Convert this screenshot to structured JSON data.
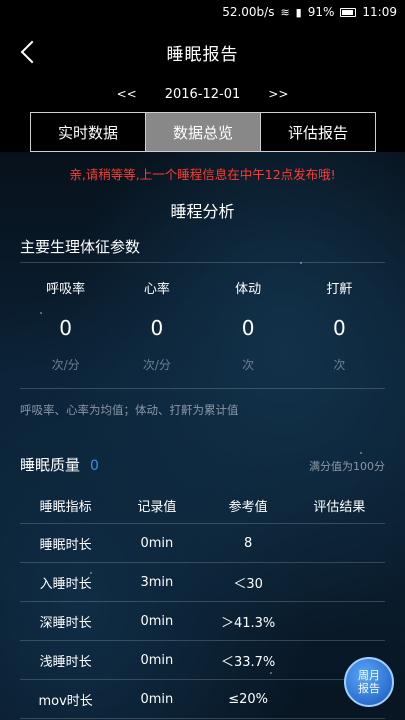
{
  "statusbar": {
    "network_speed": "52.00b/s",
    "battery_percent": "91%",
    "time": "11:09"
  },
  "appbar": {
    "title": "睡眠报告"
  },
  "datebar": {
    "prev": "<<",
    "date": "2016-12-01",
    "next": ">>"
  },
  "tabs": [
    {
      "label": "实时数据",
      "active": false
    },
    {
      "label": "数据总览",
      "active": true
    },
    {
      "label": "评估报告",
      "active": false
    }
  ],
  "notice": "亲,请稍等等,上一个睡程信息在中午12点发布哦!",
  "section_title": "睡程分析",
  "vitals": {
    "title": "主要生理体征参数",
    "metrics": [
      {
        "label": "呼吸率",
        "value": "0",
        "unit": "次/分"
      },
      {
        "label": "心率",
        "value": "0",
        "unit": "次/分"
      },
      {
        "label": "体动",
        "value": "0",
        "unit": "次"
      },
      {
        "label": "打鼾",
        "value": "0",
        "unit": "次"
      }
    ],
    "note": "呼吸率、心率为均值；体动、打鼾为累计值"
  },
  "quality": {
    "title": "睡眠质量",
    "score": "0",
    "full_score_note": "满分值为100分",
    "headers": [
      "睡眠指标",
      "记录值",
      "参考值",
      "评估结果"
    ],
    "rows": [
      {
        "name": "睡眠时长",
        "record": "0min",
        "reference": "8",
        "result": ""
      },
      {
        "name": "入睡时长",
        "record": "3min",
        "reference": "＜30",
        "result": ""
      },
      {
        "name": "深睡时长",
        "record": "0min",
        "reference": "＞41.3%",
        "result": ""
      },
      {
        "name": "浅睡时长",
        "record": "0min",
        "reference": "＜33.7%",
        "result": ""
      },
      {
        "name": "mov时长",
        "record": "0min",
        "reference": "≤20%",
        "result": ""
      }
    ]
  },
  "fab": {
    "line1": "周月",
    "line2": "报告"
  }
}
